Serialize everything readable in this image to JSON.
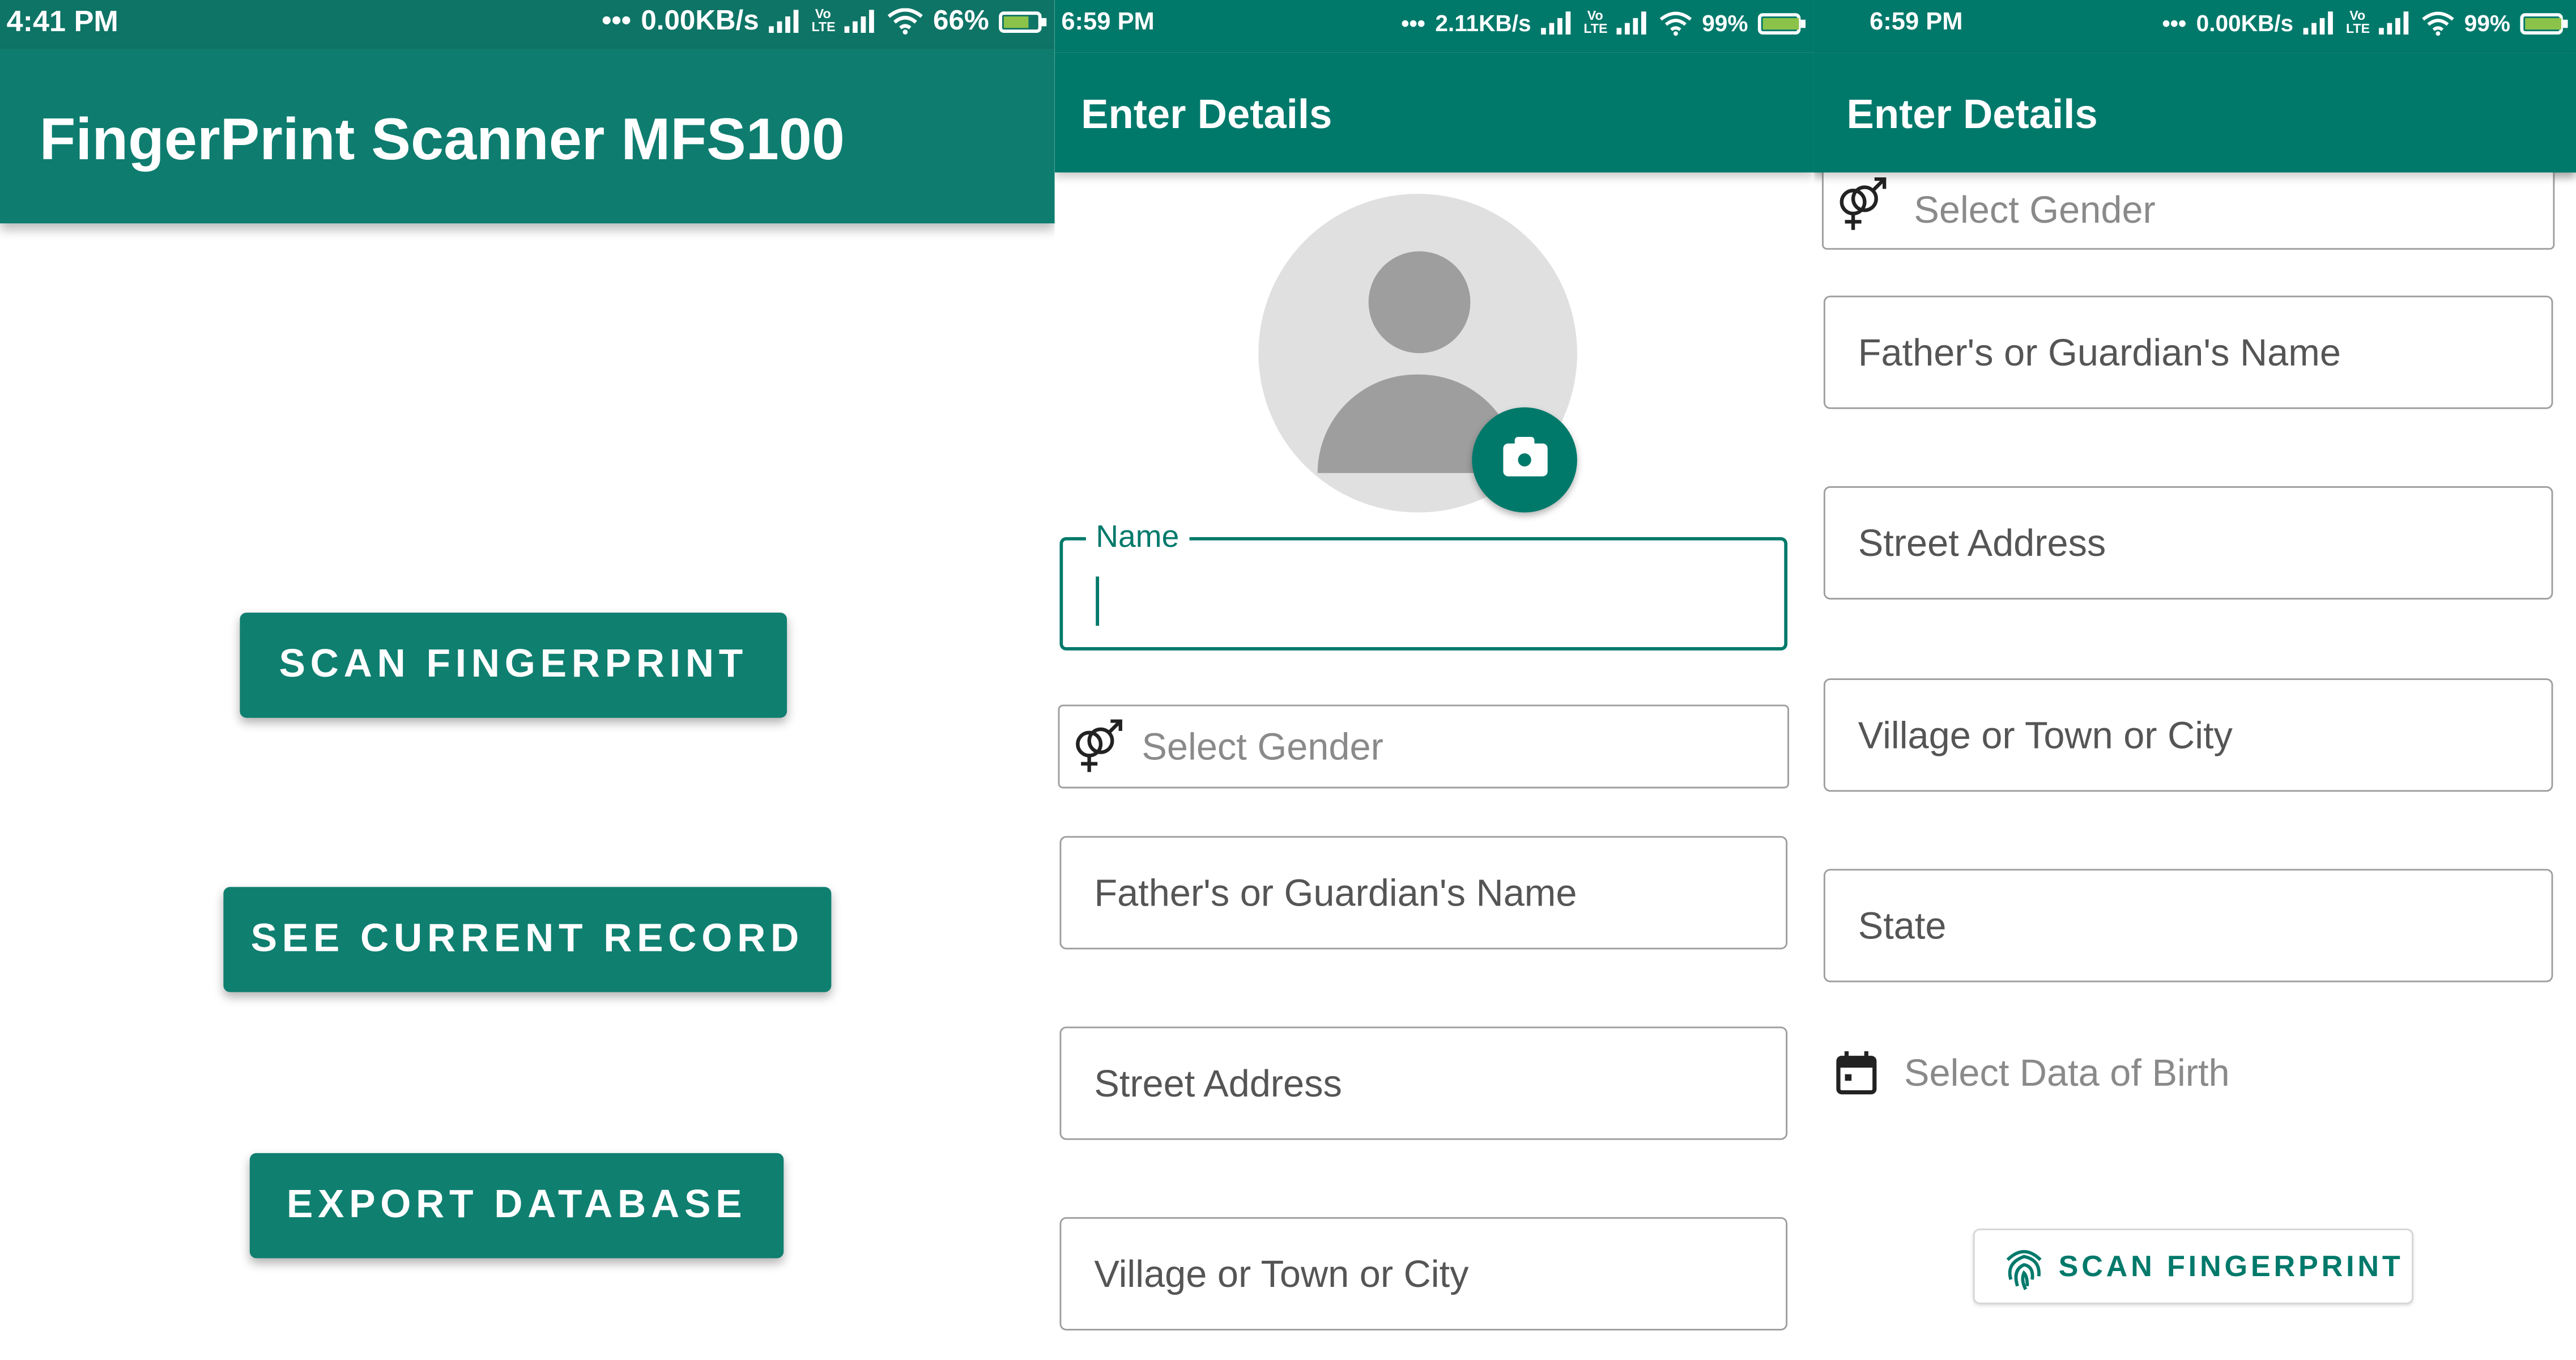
{
  "screen1": {
    "status": {
      "time": "4:41 PM",
      "speed": "0.00KB/s",
      "battery": "66%"
    },
    "title": "FingerPrint Scanner MFS100",
    "buttons": {
      "scan": "SCAN FINGERPRINT",
      "current_record": "SEE CURRENT RECORD",
      "export": "EXPORT DATABASE"
    }
  },
  "screen2": {
    "status": {
      "time": "6:59 PM",
      "speed": "2.11KB/s",
      "battery": "99%"
    },
    "title": "Enter Details",
    "name_label": "Name",
    "name_value": "",
    "gender_placeholder": "Select Gender",
    "father_placeholder": "Father's or Guardian's Name",
    "street_placeholder": "Street Address",
    "village_placeholder": "Village or Town or City"
  },
  "screen3": {
    "status": {
      "time": "6:59 PM",
      "speed": "0.00KB/s",
      "battery": "99%"
    },
    "title": "Enter Details",
    "gender_placeholder": "Select Gender",
    "father_placeholder": "Father's or Guardian's Name",
    "street_placeholder": "Street Address",
    "village_placeholder": "Village or Town or City",
    "state_placeholder": "State",
    "dob_placeholder": "Select Data of Birth",
    "scan_button": "SCAN FINGERPRINT"
  },
  "colors": {
    "primary": "#00796b",
    "battery_charge": "#8bc34a",
    "placeholder": "#8a8a8a"
  },
  "icons": [
    "signal-icon",
    "lte-icon",
    "wifi-icon",
    "battery-icon",
    "avatar-placeholder-icon",
    "camera-icon",
    "gender-icon",
    "calendar-icon",
    "fingerprint-icon"
  ]
}
